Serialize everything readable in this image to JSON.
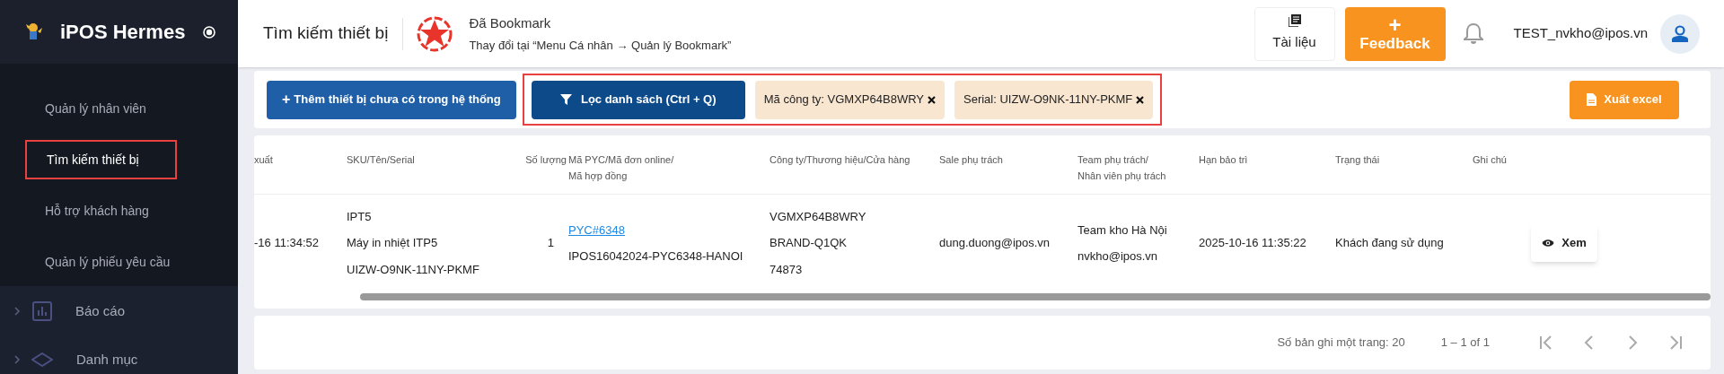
{
  "sidebar": {
    "app_name": "iPOS Hermes",
    "submenu": [
      {
        "label": "Quản lý nhân viên",
        "selected": false
      },
      {
        "label": "Tìm kiếm thiết bị",
        "selected": true
      },
      {
        "label": "Hỗ trợ khách hàng",
        "selected": false
      },
      {
        "label": "Quản lý phiếu yêu cầu",
        "selected": false
      }
    ],
    "groups": [
      {
        "label": "Báo cáo",
        "kind": "chart"
      },
      {
        "label": "Danh mục",
        "kind": "diamond"
      }
    ]
  },
  "header": {
    "title": "Tìm kiếm thiết bị",
    "bookmark_title": "Đã Bookmark",
    "bookmark_hint": "Thay đổi tại “Menu Cá nhân → Quản lý Bookmark”",
    "docs_label": "Tài liệu",
    "feedback_label": "Feedback",
    "feedback_plus": "+",
    "user": "TEST_nvkho@ipos.vn"
  },
  "toolbar": {
    "add_button": "Thêm thiết bị chưa có trong hệ thống",
    "add_plus": "+",
    "filter_button": "Lọc danh sách (Ctrl + Q)",
    "chips": [
      {
        "label": "Mã công ty: VGMXP64B8WRY"
      },
      {
        "label": "Serial: UIZW-O9NK-11NY-PKMF"
      }
    ],
    "export_button": "Xuất excel"
  },
  "table": {
    "columns": [
      "xuất",
      "SKU/Tên/Serial",
      "Số lượng",
      "Mã PYC/Mã đơn online/\nMã hợp đồng",
      "Công ty/Thương hiệu/Cửa hàng",
      "Sale phụ trách",
      "Team phụ trách/\nNhân viên phụ trách",
      "Hạn bảo trì",
      "Trạng thái",
      "Ghi chú"
    ],
    "rows": [
      {
        "cells": [
          [
            {
              "text": "-16 11:34:52",
              "link": false
            }
          ],
          [
            {
              "text": "IPT5",
              "link": false
            },
            {
              "text": "Máy in nhiệt ITP5",
              "link": false
            },
            {
              "text": "UIZW-O9NK-11NY-PKMF",
              "link": false
            }
          ],
          [
            {
              "text": "1",
              "link": false
            }
          ],
          [
            {
              "text": "PYC#6348",
              "link": true
            },
            {
              "text": "IPOS16042024-PYC6348-HANOI",
              "link": false
            }
          ],
          [
            {
              "text": "VGMXP64B8WRY",
              "link": false
            },
            {
              "text": "BRAND-Q1QK",
              "link": false
            },
            {
              "text": "74873",
              "link": false
            }
          ],
          [
            {
              "text": "dung.duong@ipos.vn",
              "link": false
            }
          ],
          [
            {
              "text": "Team kho Hà Nội",
              "link": false
            },
            {
              "text": "nvkho@ipos.vn",
              "link": false
            }
          ],
          [
            {
              "text": "2025-10-16 11:35:22",
              "link": false
            }
          ],
          [
            {
              "text": "Khách đang sử dụng",
              "link": false
            }
          ],
          []
        ],
        "action": "Xem"
      }
    ]
  },
  "pagination": {
    "page_size": "Số bản ghi một trang: 20",
    "range": "1 – 1 of 1"
  }
}
